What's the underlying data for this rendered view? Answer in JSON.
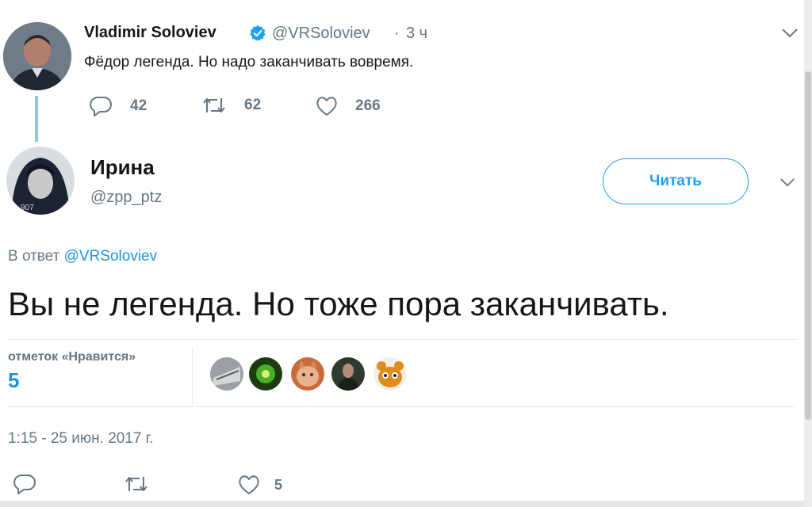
{
  "parent_tweet": {
    "author_name": "Vladimir Soloviev",
    "handle": "@VRSoloviev",
    "time": "3 ч",
    "text": "Фёдор легенда. Но надо заканчивать вовремя.",
    "replies": "42",
    "retweets": "62",
    "likes": "266",
    "verified": true
  },
  "reply_tweet": {
    "author_name": "Ирина",
    "handle": "@zpp_ptz",
    "follow_label": "Читать",
    "reply_to_prefix": "В ответ",
    "reply_to_handle": "@VRSoloviev",
    "text": "Вы не легенда. Но тоже пора заканчивать.",
    "likes_label": "отметок «Нравится»",
    "likes_count": "5",
    "timestamp": "1:15 - 25 июн. 2017 г.",
    "action_likes": "5"
  },
  "colors": {
    "accent": "#1da1f2",
    "link": "#1b95e0",
    "muted": "#657786",
    "text": "#14171a",
    "verified": "#1da1f2"
  },
  "icons": [
    "reply-icon",
    "retweet-icon",
    "like-icon",
    "chevron-down-icon",
    "verified-badge-icon"
  ]
}
